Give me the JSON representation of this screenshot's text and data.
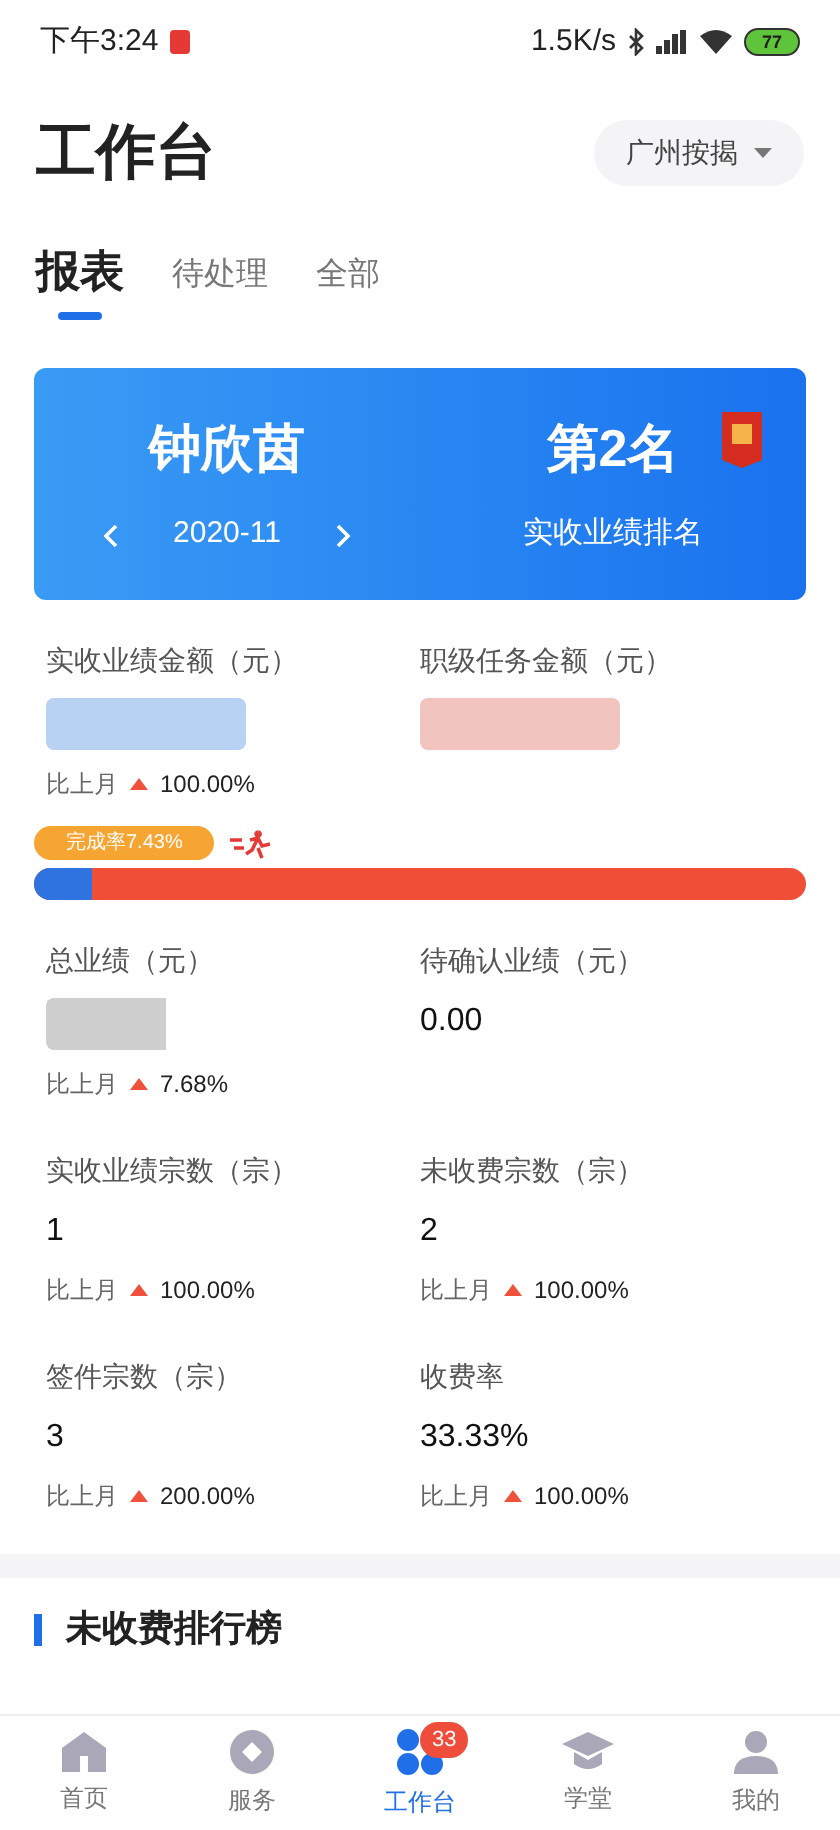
{
  "status_bar": {
    "time": "下午3:24",
    "speed": "1.5K/s",
    "battery": "77"
  },
  "header": {
    "title": "工作台",
    "city": "广州按揭"
  },
  "tabs": [
    {
      "label": "报表",
      "selected": true
    },
    {
      "label": "待处理",
      "selected": false
    },
    {
      "label": "全部",
      "selected": false
    }
  ],
  "banner": {
    "name": "钟欣茵",
    "month": "2020-11",
    "rank": "第2名",
    "rank_label": "实收业绩排名"
  },
  "top_metrics": [
    {
      "label": "实收业绩金额（元）",
      "color": "#b7d2f2",
      "compare_label": "比上月",
      "compare": "100.00%"
    },
    {
      "label": "职级任务金额（元）",
      "color": "#f2c4bf"
    }
  ],
  "progress": {
    "label": "完成率7.43%",
    "level": 0.0743
  },
  "metrics": [
    {
      "label": "总业绩（元）",
      "blurred": true,
      "compare_label": "比上月",
      "compare": "7.68%"
    },
    {
      "label": "待确认业绩（元）",
      "value": "0.00"
    },
    {
      "label": "实收业绩宗数（宗）",
      "value": "1",
      "compare_label": "比上月",
      "compare": "100.00%"
    },
    {
      "label": "未收费宗数（宗）",
      "value": "2",
      "compare_label": "比上月",
      "compare": "100.00%"
    },
    {
      "label": "签件宗数（宗）",
      "value": "3",
      "compare_label": "比上月",
      "compare": "200.00%"
    },
    {
      "label": "收费率",
      "value": "33.33%",
      "compare_label": "比上月",
      "compare": "100.00%"
    }
  ],
  "section_title": "未收费排行榜",
  "nav": [
    {
      "label": "首页",
      "kind": "home",
      "selected": false
    },
    {
      "label": "服务",
      "kind": "service",
      "selected": false
    },
    {
      "label": "工作台",
      "kind": "work",
      "selected": true,
      "badge": "33"
    },
    {
      "label": "学堂",
      "kind": "school",
      "selected": false
    },
    {
      "label": "我的",
      "kind": "me",
      "selected": false
    }
  ]
}
